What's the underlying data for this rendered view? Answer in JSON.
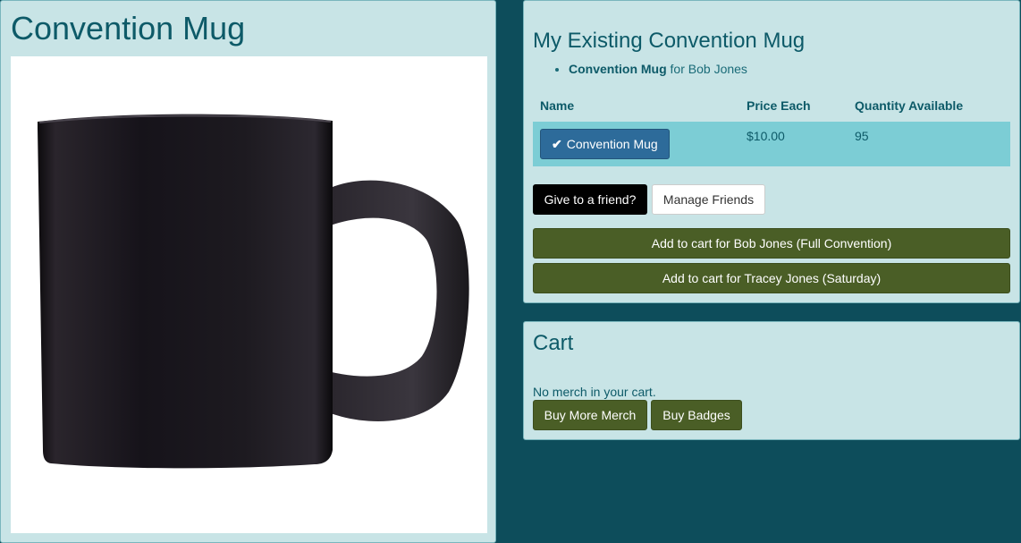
{
  "product": {
    "title": "Convention Mug",
    "image_alt": "black coffee mug"
  },
  "owned": {
    "title": "My Existing Convention Mug",
    "items": [
      {
        "name": "Convention Mug",
        "owner_text": " for Bob Jones"
      }
    ]
  },
  "table": {
    "headers": {
      "name": "Name",
      "price": "Price Each",
      "quantity": "Quantity Available"
    },
    "rows": [
      {
        "name": "Convention Mug",
        "price": "$10.00",
        "quantity": "95",
        "check_icon": "check-icon"
      }
    ]
  },
  "actions": {
    "give_label": "Give to a friend?",
    "manage_friends_label": "Manage Friends",
    "add_bob_label": "Add to cart for Bob Jones (Full Convention)",
    "add_tracey_label": "Add to cart for Tracey Jones (Saturday)"
  },
  "cart": {
    "title": "Cart",
    "empty_text": "No merch in your cart.",
    "buy_merch_label": "Buy More Merch",
    "buy_badges_label": "Buy Badges"
  },
  "colors": {
    "page_background": "#0d4d5b",
    "panel_background": "#c8e4e6",
    "heading_text": "#0d5a68",
    "selected_row": "#7ccdd5",
    "primary_button": "#2d6b9a",
    "cart_button": "#4a5e26"
  }
}
